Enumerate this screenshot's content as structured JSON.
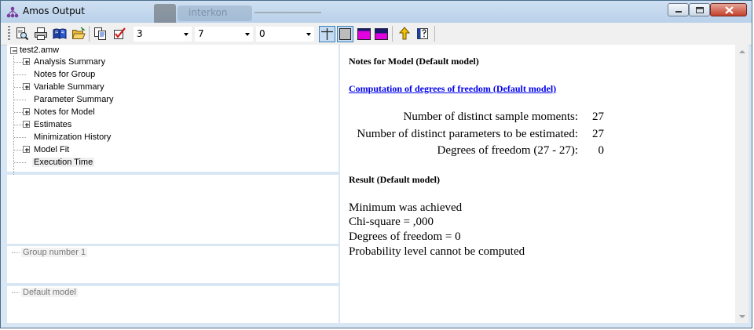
{
  "window": {
    "title": "Amos Output",
    "background_tab": "interkon"
  },
  "toolbar": {
    "icons": [
      "print-preview-icon",
      "print-icon",
      "open-book-icon",
      "open-folder-icon",
      "copy-icon",
      "checkmark-icon"
    ],
    "combo1": "3",
    "combo2": "7",
    "combo3": "0",
    "toggle_icons": [
      "table-grid-icon",
      "table-box-icon",
      "magenta-window-icon",
      "magenta-window-dark-icon",
      "up-arrow-icon",
      "help-book-icon"
    ]
  },
  "tree": {
    "root": "test2.amw",
    "items": [
      {
        "label": "Analysis Summary",
        "expandable": true
      },
      {
        "label": "Notes for Group",
        "expandable": false
      },
      {
        "label": "Variable Summary",
        "expandable": true
      },
      {
        "label": "Parameter Summary",
        "expandable": false
      },
      {
        "label": "Notes for Model",
        "expandable": true
      },
      {
        "label": "Estimates",
        "expandable": true
      },
      {
        "label": "Minimization History",
        "expandable": false
      },
      {
        "label": "Model Fit",
        "expandable": true
      },
      {
        "label": "Execution Time",
        "expandable": false
      }
    ]
  },
  "group_pane": {
    "item": "Group number 1"
  },
  "model_pane": {
    "item": "Default model"
  },
  "output": {
    "heading": "Notes for Model (Default model)",
    "link": "Computation of degrees of freedom (Default model)",
    "dof_rows": [
      {
        "label": "Number of distinct sample moments:",
        "value": "27"
      },
      {
        "label": "Number of distinct parameters to be estimated:",
        "value": "27"
      },
      {
        "label": "Degrees of freedom (27 - 27):",
        "value": "0"
      }
    ],
    "result_heading": "Result (Default model)",
    "result_lines": [
      "Minimum was achieved",
      "Chi-square = ,000",
      "Degrees of freedom = 0",
      "Probability level cannot be computed"
    ]
  },
  "colors": {
    "link": "#0000ee",
    "toggle_active": "#c6dcf4",
    "magenta": "#e000e0"
  }
}
